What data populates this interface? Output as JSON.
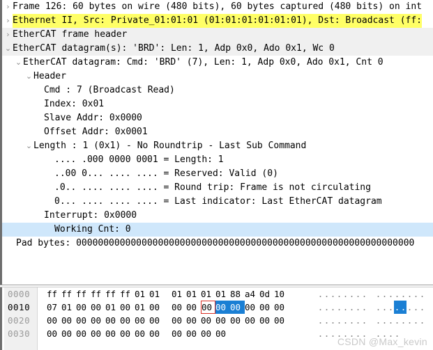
{
  "detail_tree": {
    "rows": [
      {
        "text": "Frame 126: 60 bytes on wire (480 bits), 60 bytes captured (480 bits) on int",
        "arrow": "›",
        "indent": 0,
        "band": false,
        "highlight": "none"
      },
      {
        "text": "Ethernet II, Src: Private_01:01:01 (01:01:01:01:01:01), Dst: Broadcast (ff:",
        "arrow": "›",
        "indent": 0,
        "band": false,
        "highlight": "yellow"
      },
      {
        "text": "EtherCAT frame header",
        "arrow": "›",
        "indent": 0,
        "band": true,
        "highlight": "none"
      },
      {
        "text": "EtherCAT datagram(s): 'BRD': Len: 1, Adp 0x0, Ado 0x1, Wc 0",
        "arrow": "⌄",
        "indent": 0,
        "band": true,
        "highlight": "none"
      },
      {
        "text": "EtherCAT datagram: Cmd: 'BRD' (7), Len: 1, Adp 0x0, Ado 0x1, Cnt 0",
        "arrow": "⌄",
        "indent": 1,
        "band": false,
        "highlight": "none"
      },
      {
        "text": "Header",
        "arrow": "⌄",
        "indent": 2,
        "band": false,
        "highlight": "none"
      },
      {
        "text": "Cmd        : 7 (Broadcast Read)",
        "arrow": "",
        "indent": 3,
        "band": false,
        "highlight": "none"
      },
      {
        "text": "Index: 0x01",
        "arrow": "",
        "indent": 3,
        "band": false,
        "highlight": "none"
      },
      {
        "text": "Slave Addr: 0x0000",
        "arrow": "",
        "indent": 3,
        "band": false,
        "highlight": "none"
      },
      {
        "text": "Offset Addr: 0x0001",
        "arrow": "",
        "indent": 3,
        "band": false,
        "highlight": "none"
      },
      {
        "text": "Length     : 1 (0x1) - No Roundtrip - Last Sub Command",
        "arrow": "⌄",
        "indent": 2,
        "band": false,
        "highlight": "none"
      },
      {
        "text": ".... .000 0000 0001 = Length: 1",
        "arrow": "",
        "indent": 4,
        "band": false,
        "highlight": "none"
      },
      {
        "text": "..00 0... .... .... = Reserved: Valid (0)",
        "arrow": "",
        "indent": 4,
        "band": false,
        "highlight": "none"
      },
      {
        "text": ".0.. .... .... .... = Round trip: Frame is not circulating",
        "arrow": "",
        "indent": 4,
        "band": false,
        "highlight": "none"
      },
      {
        "text": "0... .... .... .... = Last indicator: Last EtherCAT datagram",
        "arrow": "",
        "indent": 4,
        "band": false,
        "highlight": "none"
      },
      {
        "text": "Interrupt: 0x0000",
        "arrow": "",
        "indent": 3,
        "band": false,
        "highlight": "none"
      },
      {
        "text": "Working Cnt: 0",
        "arrow": "",
        "indent": 4,
        "band": false,
        "highlight": "blue"
      }
    ],
    "pad_bytes_row": "Pad bytes: 00000000000000000000000000000000000000000000000000000000000000"
  },
  "bytes_pane": {
    "rows": [
      {
        "offset": "0000",
        "offset_selected": false,
        "bytes": [
          "ff",
          "ff",
          "ff",
          "ff",
          "ff",
          "ff",
          "01",
          "01",
          "01",
          "01",
          "01",
          "01",
          "88",
          "a4",
          "0d",
          "10"
        ],
        "boxed_index": -1,
        "selected_indices": [],
        "ascii": [
          ".",
          ".",
          ".",
          ".",
          ".",
          ".",
          ".",
          ".",
          ".",
          ".",
          ".",
          ".",
          ".",
          ".",
          ".",
          "."
        ],
        "ascii_selected_indices": []
      },
      {
        "offset": "0010",
        "offset_selected": true,
        "bytes": [
          "07",
          "01",
          "00",
          "00",
          "01",
          "00",
          "01",
          "00",
          "00",
          "00",
          "00",
          "00",
          "00",
          "00",
          "00",
          "00"
        ],
        "boxed_index": 10,
        "selected_indices": [
          11,
          12
        ],
        "ascii": [
          ".",
          ".",
          ".",
          ".",
          ".",
          ".",
          ".",
          ".",
          ".",
          ".",
          ".",
          ".",
          ".",
          ".",
          ".",
          "."
        ],
        "ascii_selected_indices": [
          11,
          12
        ]
      },
      {
        "offset": "0020",
        "offset_selected": false,
        "bytes": [
          "00",
          "00",
          "00",
          "00",
          "00",
          "00",
          "00",
          "00",
          "00",
          "00",
          "00",
          "00",
          "00",
          "00",
          "00",
          "00"
        ],
        "boxed_index": -1,
        "selected_indices": [],
        "ascii": [
          ".",
          ".",
          ".",
          ".",
          ".",
          ".",
          ".",
          ".",
          ".",
          ".",
          ".",
          ".",
          ".",
          ".",
          ".",
          "."
        ],
        "ascii_selected_indices": []
      },
      {
        "offset": "0030",
        "offset_selected": false,
        "bytes": [
          "00",
          "00",
          "00",
          "00",
          "00",
          "00",
          "00",
          "00",
          "00",
          "00",
          "00",
          "00"
        ],
        "boxed_index": -1,
        "selected_indices": [],
        "ascii": [
          ".",
          ".",
          ".",
          ".",
          ".",
          ".",
          ".",
          ".",
          ".",
          ".",
          ".",
          "."
        ],
        "ascii_selected_indices": []
      }
    ]
  },
  "watermark": {
    "text": "CSDN @Max_kevin"
  },
  "colors": {
    "highlight_yellow": "#ffff66",
    "selection_blue": "#cfe7fb",
    "byte_selection_blue": "#1a7fd4",
    "red_box": "#d93025",
    "row_band_gray": "#f0f0f0"
  }
}
